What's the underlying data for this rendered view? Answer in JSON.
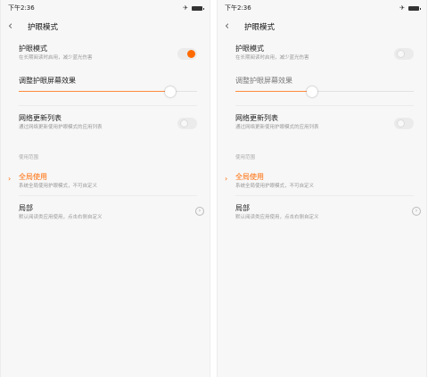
{
  "panels": [
    {
      "status": {
        "time": "下午2:36"
      },
      "header": {
        "title": "护眼模式"
      },
      "eye_mode": {
        "title": "护眼模式",
        "subtitle": "在长期阅读时启用，减少蓝光伤害",
        "enabled": true
      },
      "effect": {
        "title": "调整护眼屏幕效果",
        "level": 0.85
      },
      "network": {
        "title": "网络更新列表",
        "subtitle": "通过网络更新使用护眼模式的应用列表",
        "enabled": false
      },
      "scope": {
        "label": "使用范围",
        "global": {
          "title": "全局使用",
          "subtitle": "系统全局使用护眼模式，不可自定义",
          "selected": true
        },
        "local": {
          "title": "局部",
          "subtitle": "默认阅读类应用使用，点击右侧自定义",
          "selected": false
        }
      }
    },
    {
      "status": {
        "time": "下午2:36"
      },
      "header": {
        "title": "护眼模式"
      },
      "eye_mode": {
        "title": "护眼模式",
        "subtitle": "在长期阅读时启用，减少蓝光伤害",
        "enabled": false
      },
      "effect": {
        "title": "调整护眼屏幕效果",
        "level": 0.43
      },
      "network": {
        "title": "网络更新列表",
        "subtitle": "通过网络更新使用护眼模式的应用列表",
        "enabled": false
      },
      "scope": {
        "label": "使用范围",
        "global": {
          "title": "全局使用",
          "subtitle": "系统全局使用护眼模式，不可自定义",
          "selected": true
        },
        "local": {
          "title": "局部",
          "subtitle": "默认阅读类应用使用，点击右侧自定义",
          "selected": false
        }
      }
    }
  ],
  "icons": {
    "back": "chevron-left-icon",
    "airplane": "airplane-icon",
    "battery": "battery-icon",
    "info": "chevron-right-circle-icon",
    "selector": "chevron-right-icon"
  },
  "colors": {
    "accent": "#ff6a00"
  }
}
